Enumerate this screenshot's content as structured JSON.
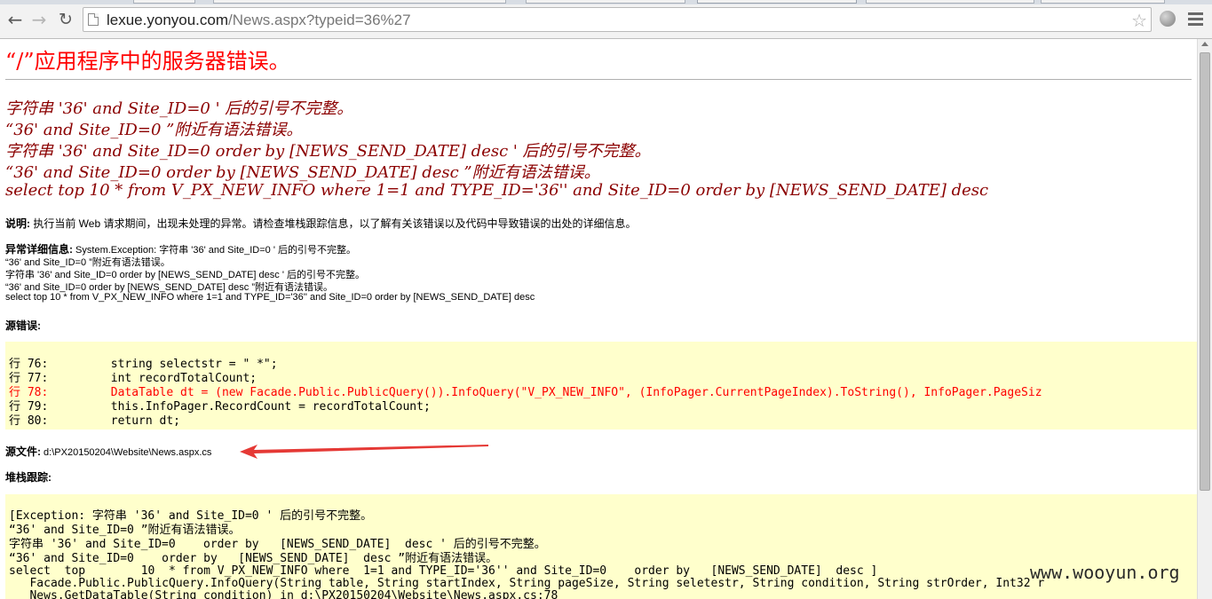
{
  "browser": {
    "url_host": "lexue.yonyou.com",
    "url_path": "/News.aspx?typeid=36%27",
    "icons": {
      "back": "back-arrow-icon",
      "forward": "forward-arrow-icon",
      "reload": "reload-icon",
      "bookmark": "star-icon",
      "extension": "globe-icon",
      "menu": "hamburger-menu-icon"
    }
  },
  "error_page": {
    "title": "“/”应用程序中的服务器错误。",
    "headlines": [
      "字符串 '36' and Site_ID=0 ' 后的引号不完整。",
      "“36' and Site_ID=0 ”附近有语法错误。",
      "字符串 '36' and Site_ID=0    order by   [NEWS_SEND_DATE]  desc ' 后的引号不完整。",
      "“36' and Site_ID=0    order by   [NEWS_SEND_DATE]  desc ”附近有语法错误。",
      "select  top        10  * from V_PX_NEW_INFO where  1=1 and TYPE_ID='36'' and Site_ID=0    order by   [NEWS_SEND_DATE]  desc"
    ],
    "description": {
      "label": "说明:",
      "text": " 执行当前 Web 请求期间，出现未处理的异常。请检查堆栈跟踪信息，以了解有关该错误以及代码中导致错误的出处的详细信息。"
    },
    "exception_details": {
      "label": "异常详细信息:",
      "first_line": " System.Exception: 字符串 '36' and Site_ID=0 ' 后的引号不完整。",
      "lines": [
        "“36' and Site_ID=0 ”附近有语法错误。",
        "字符串 '36' and Site_ID=0    order by   [NEWS_SEND_DATE]  desc ' 后的引号不完整。",
        "“36' and Site_ID=0    order by   [NEWS_SEND_DATE]  desc ”附近有语法错误。",
        "select  top        10  * from V_PX_NEW_INFO where  1=1 and TYPE_ID='36'' and Site_ID=0    order by   [NEWS_SEND_DATE]  desc"
      ]
    },
    "source_error": {
      "label": "源错误:",
      "lines": [
        "行 76:         string selectstr = \" *\";",
        "行 77:         int recordTotalCount;",
        "行 78:         DataTable dt = (new Facade.Public.PublicQuery()).InfoQuery(\"V_PX_NEW_INFO\", (InfoPager.CurrentPageIndex).ToString(), InfoPager.PageSiz",
        "行 79:         this.InfoPager.RecordCount = recordTotalCount;",
        "行 80:         return dt;"
      ],
      "highlighted_line": "行 78"
    },
    "source_file": {
      "label": "源文件:",
      "path": " d:\\PX20150204\\Website\\News.aspx.cs"
    },
    "stack_trace": {
      "label": "堆栈跟踪:",
      "lines": [
        "[Exception: 字符串 '36' and Site_ID=0 ' 后的引号不完整。",
        "“36' and Site_ID=0 ”附近有语法错误。",
        "字符串 '36' and Site_ID=0    order by   [NEWS_SEND_DATE]  desc ' 后的引号不完整。",
        "“36' and Site_ID=0    order by   [NEWS_SEND_DATE]  desc ”附近有语法错误。",
        "select  top        10  * from V_PX_NEW_INFO where  1=1 and TYPE_ID='36'' and Site_ID=0    order by   [NEWS_SEND_DATE]  desc ]",
        "   Facade.Public.PublicQuery.InfoQuery(String table, String startIndex, String pageSize, String seletestr, String condition, String strOrder, Int32 r",
        "   News.GetDataTable(String condition) in d:\\PX20150204\\Website\\News.aspx.cs:78"
      ]
    }
  },
  "annotation": {
    "arrow_color": "#e53935",
    "watermark": "www.wooyun.org"
  },
  "colors": {
    "title": "#ff0000",
    "headline": "#8b0000",
    "code_background": "#ffffcc",
    "highlight_line": "#ff0000"
  }
}
